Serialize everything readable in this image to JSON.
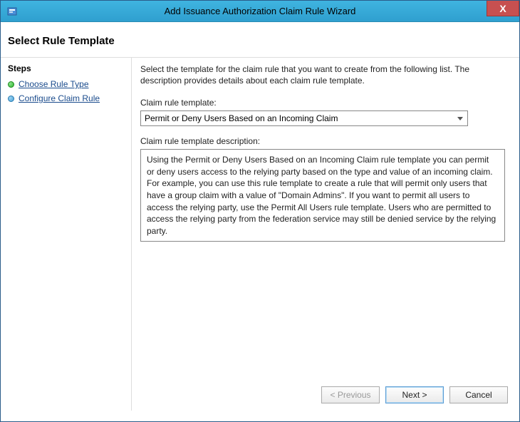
{
  "titlebar": {
    "title": "Add Issuance Authorization Claim Rule Wizard",
    "close": "X"
  },
  "header": {
    "title": "Select Rule Template"
  },
  "sidebar": {
    "heading": "Steps",
    "items": [
      {
        "label": "Choose Rule Type"
      },
      {
        "label": "Configure Claim Rule"
      }
    ]
  },
  "main": {
    "intro": "Select the template for the claim rule that you want to create from the following list. The description provides details about each claim rule template.",
    "template_label": "Claim rule template:",
    "template_selected": "Permit or Deny Users Based on an Incoming Claim",
    "description_label": "Claim rule template description:",
    "description_text": "Using the Permit or Deny Users Based on an Incoming Claim rule template you can permit or deny users access to the relying party based on the type and value of an incoming claim.  For example, you can use this rule template to create a rule that will permit only users that have a group claim with a value of \"Domain Admins\".  If you want to permit all users to access the relying party, use the Permit All Users rule template.  Users who are permitted to access the relying party from the federation service may still be denied service by the relying party."
  },
  "buttons": {
    "previous": "< Previous",
    "next": "Next >",
    "cancel": "Cancel"
  }
}
